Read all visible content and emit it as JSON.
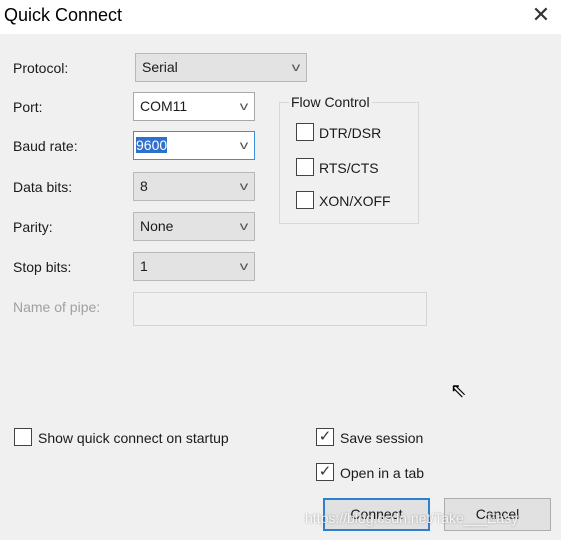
{
  "window": {
    "title": "Quick Connect",
    "close_icon": "close-icon"
  },
  "fields": {
    "protocol": {
      "label": "Protocol:",
      "value": "Serial"
    },
    "port": {
      "label": "Port:",
      "value": "COM11"
    },
    "baud_rate": {
      "label": "Baud rate:",
      "value": "9600"
    },
    "data_bits": {
      "label": "Data bits:",
      "value": "8"
    },
    "parity": {
      "label": "Parity:",
      "value": "None"
    },
    "stop_bits": {
      "label": "Stop bits:",
      "value": "1"
    },
    "name_of_pipe": {
      "label": "Name of pipe:",
      "value": ""
    }
  },
  "flow_control": {
    "legend": "Flow Control",
    "options": [
      {
        "label": "DTR/DSR",
        "checked": false
      },
      {
        "label": "RTS/CTS",
        "checked": false
      },
      {
        "label": "XON/XOFF",
        "checked": false
      }
    ]
  },
  "options": {
    "show_on_startup": {
      "label": "Show quick connect on startup",
      "checked": false
    },
    "save_session": {
      "label": "Save session",
      "checked": true
    },
    "open_in_tab": {
      "label": "Open in a tab",
      "checked": true
    }
  },
  "buttons": {
    "connect": "Connect",
    "cancel": "Cancel"
  },
  "watermark": "https://blog.csdn.net/Take___Easy",
  "colors": {
    "focus": "#3c8fd8",
    "selection": "#2f6fce"
  }
}
